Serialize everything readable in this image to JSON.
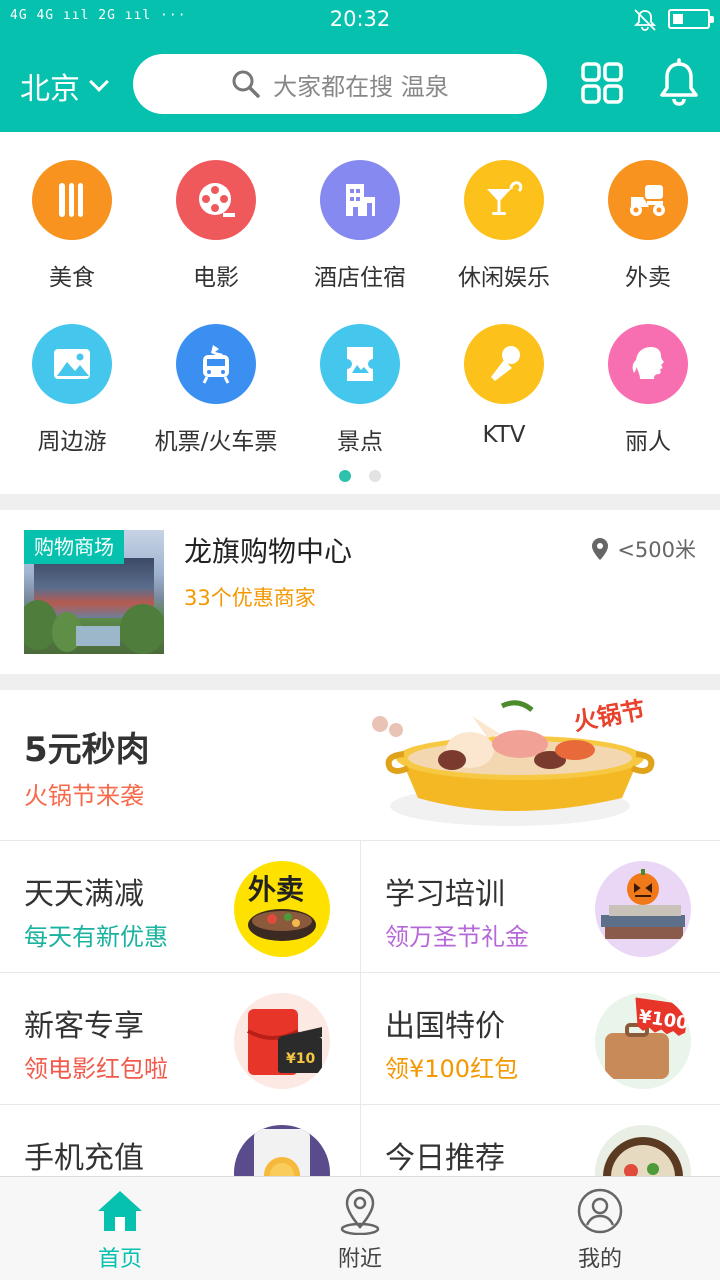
{
  "status_bar": {
    "signal": "4G 4G ııl  2G ııl  ···",
    "time": "20:32"
  },
  "header": {
    "city": "北京",
    "search_placeholder": "大家都在搜 温泉",
    "icons": [
      "search-icon",
      "qr-scan-icon",
      "bell-icon"
    ],
    "accent_color": "#06c1ae"
  },
  "categories": [
    {
      "label": "美食",
      "icon": "fork-knife-icon",
      "color": "#f7931e"
    },
    {
      "label": "电影",
      "icon": "film-reel-icon",
      "color": "#f0595c"
    },
    {
      "label": "酒店住宿",
      "icon": "hotel-icon",
      "color": "#8689f0"
    },
    {
      "label": "休闲娱乐",
      "icon": "cocktail-icon",
      "color": "#fcc11a"
    },
    {
      "label": "外卖",
      "icon": "delivery-scooter-icon",
      "color": "#f7931e"
    },
    {
      "label": "周边游",
      "icon": "landscape-icon",
      "color": "#45c6ec"
    },
    {
      "label": "机票/火车票",
      "icon": "plane-train-icon",
      "color": "#3b8ff0"
    },
    {
      "label": "景点",
      "icon": "ticket-icon",
      "color": "#45c6ec"
    },
    {
      "label": "KTV",
      "icon": "microphone-icon",
      "color": "#fcc11a"
    },
    {
      "label": "丽人",
      "icon": "lady-profile-icon",
      "color": "#f76fb0"
    }
  ],
  "pager": {
    "pages": 2,
    "active": 0
  },
  "mall": {
    "tag": "购物商场",
    "name": "龙旗购物中心",
    "deals": "33个优惠商家",
    "distance": "<500米"
  },
  "promo": {
    "title": "5元秒肉",
    "subtitle": "火锅节来袭",
    "art_text": "火锅节"
  },
  "deals": [
    {
      "title": "天天满减",
      "subtitle": "每天有新优惠",
      "sub_color": "#1bb2a0",
      "thumb": "takeout-bowl",
      "thumb_text": "外卖"
    },
    {
      "title": "学习培训",
      "subtitle": "领万圣节礼金",
      "sub_color": "#b568d8",
      "thumb": "books-pumpkin",
      "thumb_text": ""
    },
    {
      "title": "新客专享",
      "subtitle": "领电影红包啦",
      "sub_color": "#f15a4a",
      "thumb": "movie-redpacket",
      "thumb_text": "¥10"
    },
    {
      "title": "出国特价",
      "subtitle": "领¥100红包",
      "sub_color": "#f39800",
      "thumb": "suitcase-coupon",
      "thumb_text": "¥100"
    },
    {
      "title": "手机充值",
      "subtitle": "",
      "sub_color": "#333333",
      "thumb": "phone-coin",
      "thumb_text": ""
    },
    {
      "title": "今日推荐",
      "subtitle": "",
      "sub_color": "#333333",
      "thumb": "food-bowl",
      "thumb_text": ""
    }
  ],
  "tabbar": [
    {
      "label": "首页",
      "icon": "home-icon",
      "active": true
    },
    {
      "label": "附近",
      "icon": "location-pin-icon",
      "active": false
    },
    {
      "label": "我的",
      "icon": "profile-icon",
      "active": false
    }
  ]
}
